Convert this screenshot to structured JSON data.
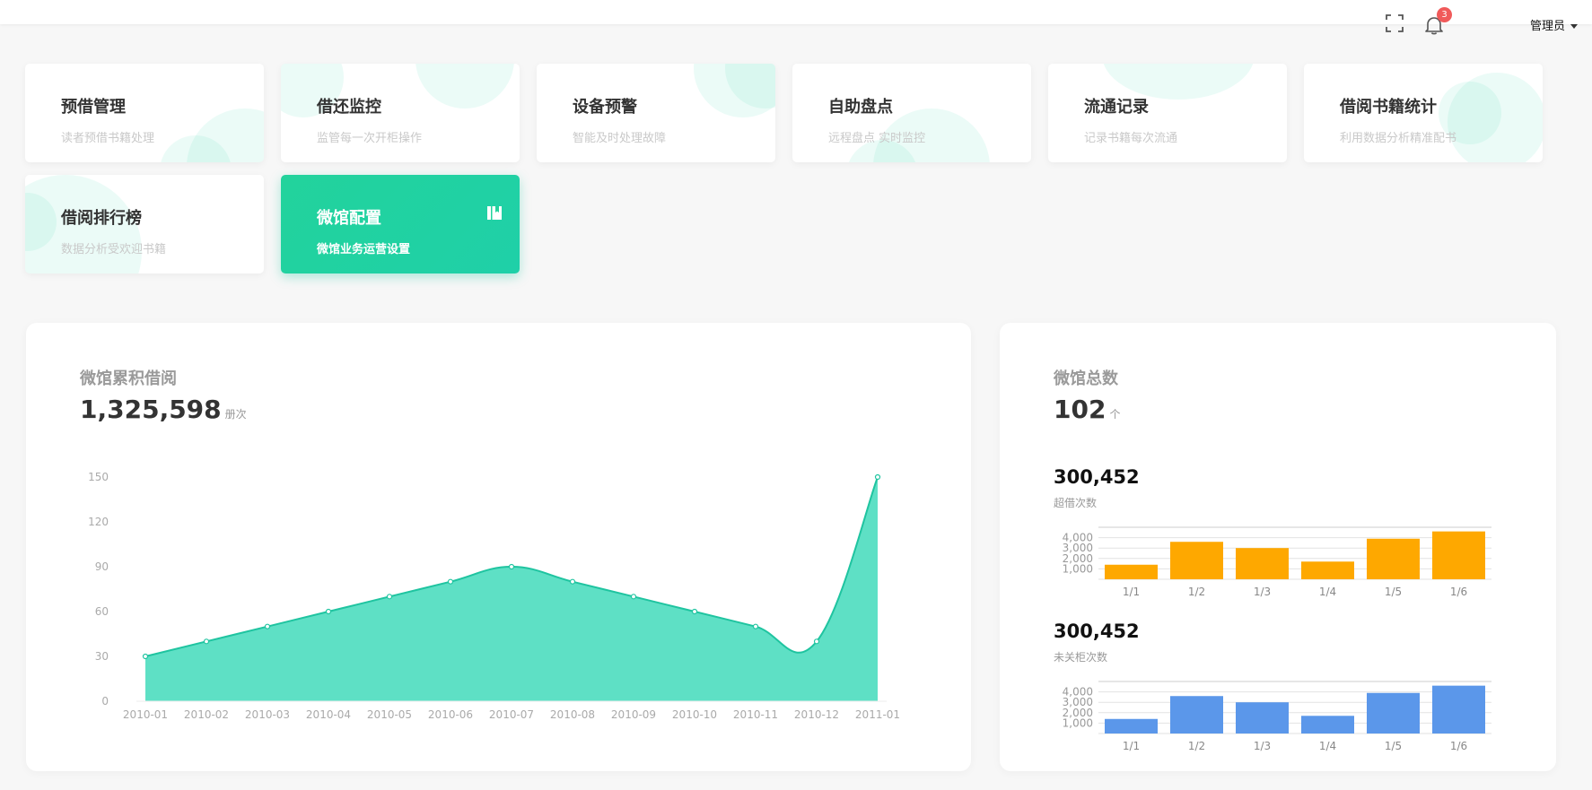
{
  "header": {
    "notification_count": "3",
    "user_name": "管理员",
    "icons": [
      "fullscreen-icon",
      "bell-icon",
      "caret-down-icon"
    ]
  },
  "modules": [
    {
      "title": "预借管理",
      "desc": "读者预借书籍处理"
    },
    {
      "title": "借还监控",
      "desc": "监管每一次开柜操作"
    },
    {
      "title": "设备预警",
      "desc": "智能及时处理故障"
    },
    {
      "title": "自助盘点",
      "desc": "远程盘点 实时监控"
    },
    {
      "title": "流通记录",
      "desc": "记录书籍每次流通"
    },
    {
      "title": "借阅书籍统计",
      "desc": "利用数据分析精准配书"
    },
    {
      "title": "借阅排行榜",
      "desc": "数据分析受欢迎书籍"
    },
    {
      "title": "微馆配置",
      "desc": "微馆业务运营设置",
      "icon": "book-icon",
      "active": true
    }
  ],
  "left_panel": {
    "title": "微馆累积借阅",
    "value": "1,325,598",
    "unit": "册次"
  },
  "right_panel": {
    "title": "微馆总数",
    "value": "102",
    "unit": "个",
    "sub1": {
      "value": "300,452",
      "label": "超借次数"
    },
    "sub2": {
      "value": "300,452",
      "label": "未关柜次数"
    }
  },
  "colors": {
    "accent": "#22d39c",
    "area_fill": "#5ee0c5",
    "area_line": "#1fc4a0",
    "bar_orange": "#fea800",
    "bar_blue": "#5b97ea",
    "badge": "#f05a5a"
  },
  "chart_data": [
    {
      "type": "area",
      "x": [
        "2010-01",
        "2010-02",
        "2010-03",
        "2010-04",
        "2010-05",
        "2010-06",
        "2010-07",
        "2010-08",
        "2010-09",
        "2010-10",
        "2010-11",
        "2010-12",
        "2011-01"
      ],
      "values": [
        30,
        40,
        50,
        60,
        70,
        80,
        90,
        80,
        70,
        60,
        50,
        40,
        150
      ],
      "yticks": [
        0,
        30,
        60,
        90,
        120,
        150
      ],
      "ylim": [
        0,
        150
      ],
      "grid": false
    },
    {
      "type": "bar",
      "categories": [
        "1/1",
        "1/2",
        "1/3",
        "1/4",
        "1/5",
        "1/6"
      ],
      "values": [
        1400,
        3600,
        3000,
        1700,
        3900,
        4600
      ],
      "yticks": [
        "1,000",
        "2,000",
        "3,000",
        "4,000"
      ],
      "ylim": [
        0,
        5000
      ],
      "grid": true,
      "color": "#fea800"
    },
    {
      "type": "bar",
      "categories": [
        "1/1",
        "1/2",
        "1/3",
        "1/4",
        "1/5",
        "1/6"
      ],
      "values": [
        1400,
        3600,
        3000,
        1700,
        3900,
        4600
      ],
      "yticks": [
        "1,000",
        "2,000",
        "3,000",
        "4,000"
      ],
      "ylim": [
        0,
        5000
      ],
      "grid": true,
      "color": "#5b97ea"
    }
  ]
}
